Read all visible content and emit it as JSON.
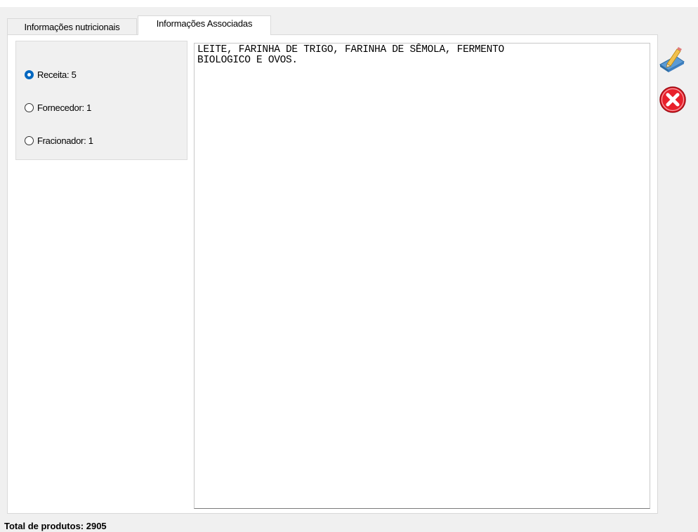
{
  "tabs": [
    {
      "label": "Informações nutricionais",
      "active": false
    },
    {
      "label": "Informações Associadas",
      "active": true
    }
  ],
  "options": [
    {
      "label": "Receita: 5",
      "checked": true
    },
    {
      "label": "Fornecedor: 1",
      "checked": false
    },
    {
      "label": "Fracionador: 1",
      "checked": false
    }
  ],
  "content": {
    "text": "LEITE, FARINHA DE TRIGO, FARINHA DE SÊMOLA, FERMENTO\nBIOLOGICO E OVOS."
  },
  "toolbar": {
    "edit_icon": "edit-pencil-icon",
    "close_icon": "close-x-icon"
  },
  "status": {
    "total_products": "Total de produtos: 2905"
  },
  "colors": {
    "accent": "#0067c0",
    "close_red": "#e8202b",
    "window_bg": "#f0f0f0"
  }
}
